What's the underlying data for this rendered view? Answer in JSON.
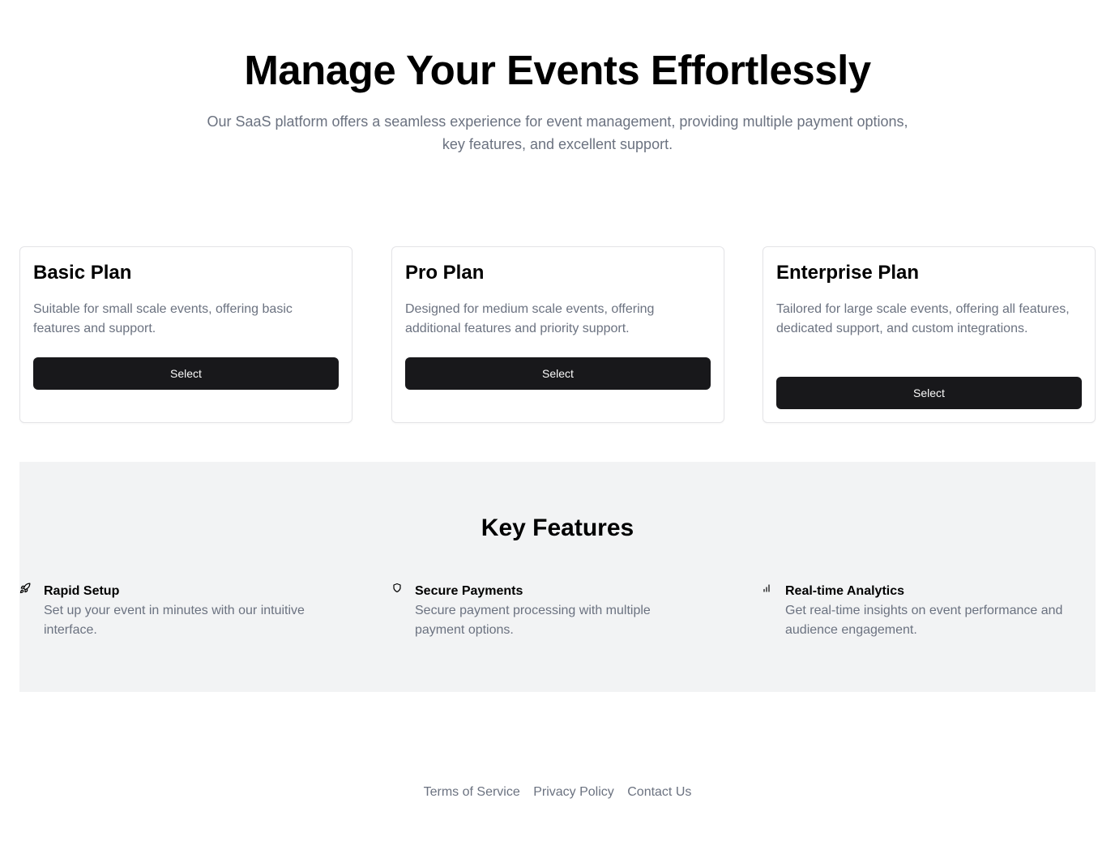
{
  "hero": {
    "title": "Manage Your Events Effortlessly",
    "subtitle": "Our SaaS platform offers a seamless experience for event management, providing multiple payment options, key features, and excellent support."
  },
  "plans": [
    {
      "name": "Basic Plan",
      "description": "Suitable for small scale events, offering basic features and support.",
      "button_label": "Select"
    },
    {
      "name": "Pro Plan",
      "description": "Designed for medium scale events, offering additional features and priority support.",
      "button_label": "Select"
    },
    {
      "name": "Enterprise Plan",
      "description": "Tailored for large scale events, offering all features, dedicated support, and custom integrations.",
      "button_label": "Select"
    }
  ],
  "features": {
    "title": "Key Features",
    "items": [
      {
        "icon": "rocket-icon",
        "title": "Rapid Setup",
        "description": "Set up your event in minutes with our intuitive interface."
      },
      {
        "icon": "shield-icon",
        "title": "Secure Payments",
        "description": "Secure payment processing with multiple payment options."
      },
      {
        "icon": "bar-chart-icon",
        "title": "Real-time Analytics",
        "description": "Get real-time insights on event performance and audience engagement."
      }
    ]
  },
  "footer": {
    "links": [
      "Terms of Service",
      "Privacy Policy",
      "Contact Us"
    ]
  },
  "colors": {
    "button_bg": "#18181b",
    "button_text": "#fafafa",
    "muted_text": "#6b7280",
    "features_bg": "#f2f3f4",
    "card_border": "#e4e4e7"
  }
}
